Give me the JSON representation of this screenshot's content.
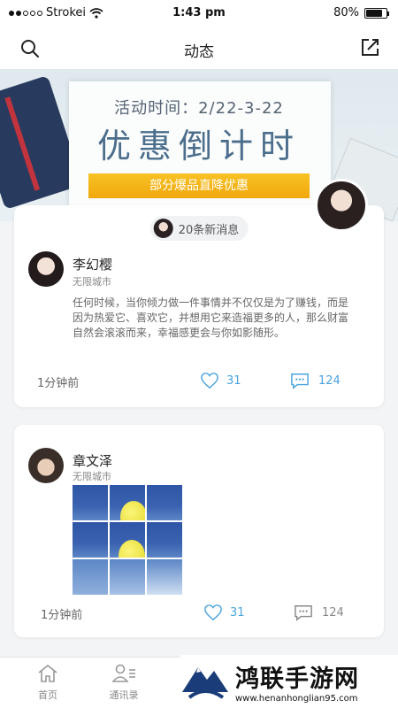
{
  "status_bar": {
    "carrier": "Strokei",
    "time": "1:43 pm",
    "battery": "80%",
    "battery_level": 0.8
  },
  "nav": {
    "title": "动态",
    "left_icon": "search-icon",
    "right_icon": "compose-icon"
  },
  "banner": {
    "date_text": "活动时间：2/22-3-22",
    "headline": "优惠倒计时",
    "ribbon": "部分爆品直降优惠"
  },
  "feed": {
    "new_messages": "20条新消息",
    "posts": [
      {
        "user": "李幻樱",
        "location": "无限城市",
        "text": "任何时候，当你倾力做一件事情并不仅仅是为了赚钱，而是因为热爱它、喜欢它，并想用它来造福更多的人，那么财富自然会滚滚而来，幸福感更会与你如影随形。",
        "time": "1分钟前",
        "likes": "31",
        "comments": "124"
      },
      {
        "user": "章文泽",
        "location": "无限城市",
        "time": "1分钟前",
        "likes": "31",
        "comments": "124"
      }
    ]
  },
  "tabbar": {
    "home": "首页",
    "contacts": "通讯录"
  },
  "watermark": {
    "title": "鸿联手游网",
    "url": "www.henanhonglian95.com"
  },
  "colors": {
    "accent": "#4aa3df",
    "ribbon": "#f3b21a",
    "headline": "#4b6e8c"
  }
}
